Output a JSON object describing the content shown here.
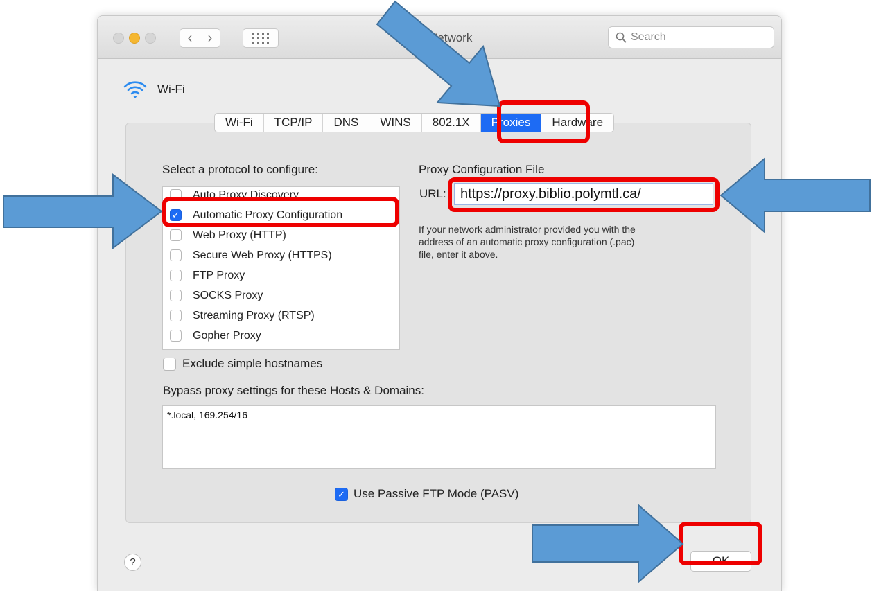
{
  "window": {
    "title": "Network",
    "search_placeholder": "Search"
  },
  "interface": {
    "name": "Wi-Fi"
  },
  "tabs": [
    {
      "label": "Wi-Fi"
    },
    {
      "label": "TCP/IP"
    },
    {
      "label": "DNS"
    },
    {
      "label": "WINS"
    },
    {
      "label": "802.1X"
    },
    {
      "label": "Proxies",
      "active": true
    },
    {
      "label": "Hardware"
    }
  ],
  "protocols": {
    "heading": "Select a protocol to configure:",
    "items": [
      {
        "label": "Auto Proxy Discovery",
        "checked": false
      },
      {
        "label": "Automatic Proxy Configuration",
        "checked": true
      },
      {
        "label": "Web Proxy (HTTP)",
        "checked": false
      },
      {
        "label": "Secure Web Proxy (HTTPS)",
        "checked": false
      },
      {
        "label": "FTP Proxy",
        "checked": false
      },
      {
        "label": "SOCKS Proxy",
        "checked": false
      },
      {
        "label": "Streaming Proxy (RTSP)",
        "checked": false
      },
      {
        "label": "Gopher Proxy",
        "checked": false
      }
    ]
  },
  "config": {
    "heading": "Proxy Configuration File",
    "url_label": "URL:",
    "url_value": "https://proxy.biblio.polymtl.ca/",
    "help_lines": [
      "If your network administrator provided you with the",
      "address of an automatic proxy configuration (.pac)",
      "file, enter it above."
    ]
  },
  "exclude_simple": {
    "label": "Exclude simple hostnames",
    "checked": false
  },
  "bypass": {
    "label": "Bypass proxy settings for these Hosts & Domains:",
    "value": "*.local, 169.254/16"
  },
  "passive_ftp": {
    "label": "Use Passive FTP Mode (PASV)",
    "checked": true
  },
  "buttons": {
    "help": "?",
    "ok": "OK"
  },
  "colors": {
    "accent": "#1d6bf4",
    "highlight": "#ee0000",
    "arrow": "#5b9bd5"
  }
}
